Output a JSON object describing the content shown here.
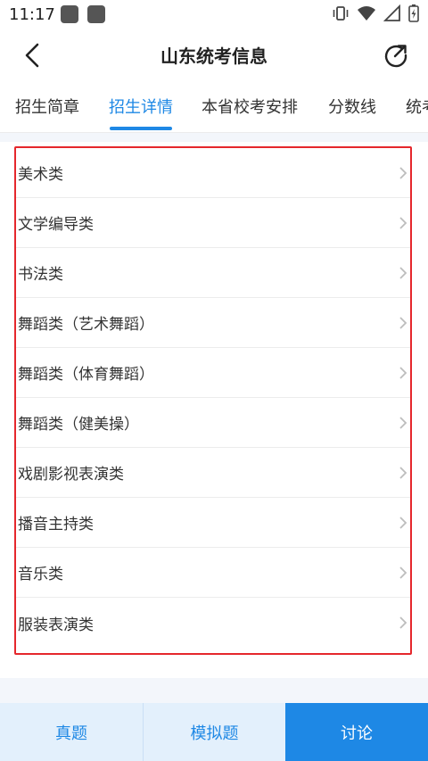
{
  "status_bar": {
    "time": "11:17"
  },
  "app_bar": {
    "title": "山东统考信息"
  },
  "tabs": [
    {
      "label": "招生简章"
    },
    {
      "label": "招生详情"
    },
    {
      "label": "本省校考安排"
    },
    {
      "label": "分数线"
    },
    {
      "label": "统考"
    }
  ],
  "list": {
    "items": [
      {
        "label": "美术类"
      },
      {
        "label": "文学编导类"
      },
      {
        "label": "书法类"
      },
      {
        "label": "舞蹈类（艺术舞蹈）"
      },
      {
        "label": "舞蹈类（体育舞蹈）"
      },
      {
        "label": "舞蹈类（健美操）"
      },
      {
        "label": "戏剧影视表演类"
      },
      {
        "label": "播音主持类"
      },
      {
        "label": "音乐类"
      },
      {
        "label": "服装表演类"
      }
    ]
  },
  "bottom_bar": {
    "exam_label": "真题",
    "mock_label": "模拟题",
    "discuss_label": "讨论"
  },
  "colors": {
    "accent": "#1e88e5",
    "highlight_border": "#e5272c",
    "light_button_bg": "#e3f0fc"
  }
}
